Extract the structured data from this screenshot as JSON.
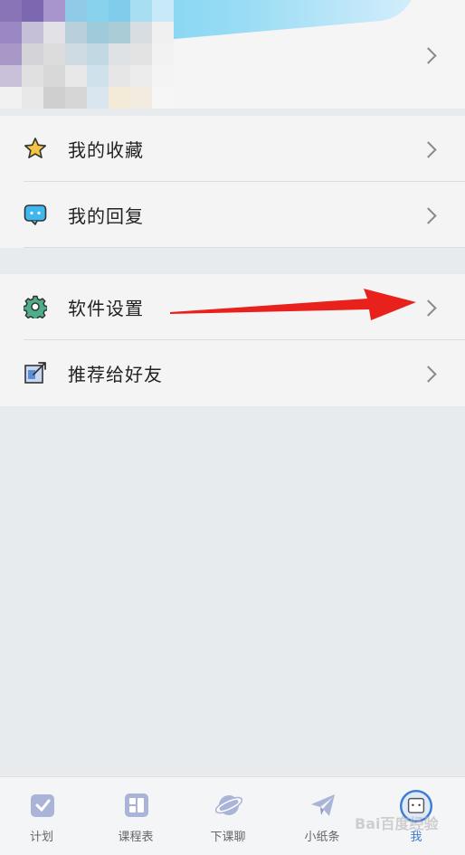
{
  "menu": {
    "favorites_label": "我的收藏",
    "replies_label": "我的回复",
    "settings_label": "软件设置",
    "recommend_label": "推荐给好友"
  },
  "tabs": [
    {
      "label": "计划",
      "icon": "plan-icon"
    },
    {
      "label": "课程表",
      "icon": "schedule-icon"
    },
    {
      "label": "下课聊",
      "icon": "chat-planet-icon"
    },
    {
      "label": "小纸条",
      "icon": "paper-plane-icon"
    },
    {
      "label": "我",
      "icon": "avatar-icon",
      "active": true
    }
  ],
  "colors": {
    "accent": "#3a7bd5",
    "arrow": "#e8211c",
    "star": "#f6c343",
    "bubble": "#3fb8f0",
    "gear": "#4fae8a",
    "share": "#5a8fd6"
  },
  "watermark": "Bai百度经验"
}
